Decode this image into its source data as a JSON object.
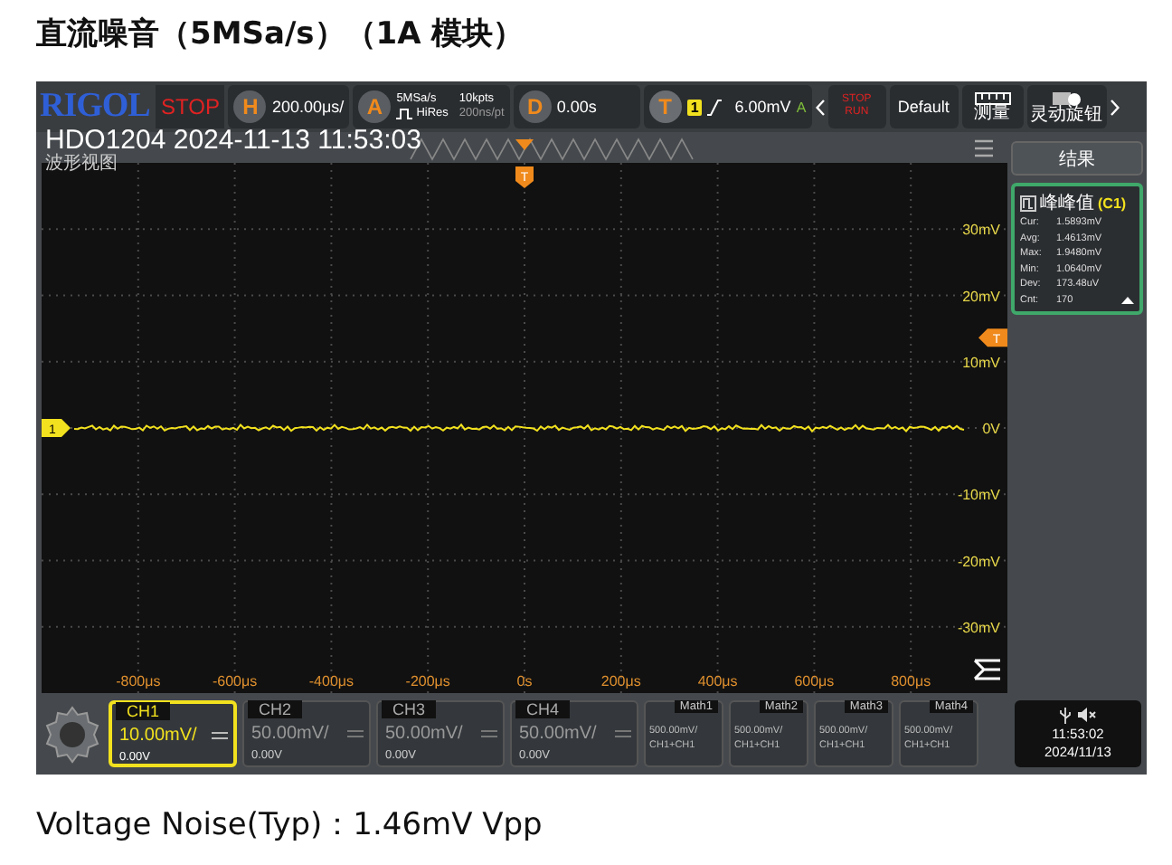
{
  "heading": "直流噪音（5MSa/s）（1A 模块）",
  "scope": {
    "top_bar": {
      "logo": "RIGOL",
      "run_state": "STOP",
      "horizontal": {
        "key": "H",
        "value": "200.00μs/"
      },
      "acquire": {
        "key": "A",
        "sample_rate": "5MSa/s",
        "depth": "10kpts",
        "mode": "HiRes",
        "interval": "200ns/pt"
      },
      "delay": {
        "key": "D",
        "value": "0.00s"
      },
      "trigger": {
        "key": "T",
        "source": "1",
        "level": "6.00mV",
        "mode": "A"
      },
      "buttons": [
        {
          "kind": "run_stop",
          "top": "STOP",
          "bottom": "RUN"
        },
        {
          "kind": "default",
          "label": "Default"
        },
        {
          "kind": "measure",
          "label": "测量"
        },
        {
          "kind": "knob",
          "label": "灵动旋钮"
        }
      ]
    },
    "overlay_title": "HDO1204 2024-11-13 11:53:03",
    "view_label": "波形视图",
    "grid": {
      "y_labels": [
        "30mV",
        "20mV",
        "10mV",
        "0V",
        "-10mV",
        "-20mV",
        "-30mV"
      ],
      "x_labels": [
        "-800μs",
        "-600μs",
        "-400μs",
        "-200μs",
        "0s",
        "200μs",
        "400μs",
        "600μs",
        "800μs"
      ],
      "channel_marker": "1",
      "trigger_position_marker": "T",
      "trigger_level_marker": "T"
    },
    "results": {
      "title": "结果",
      "card": {
        "title": "峰峰值",
        "source": "(C1)",
        "rows": [
          {
            "label": "Cur:",
            "value": "1.5893mV"
          },
          {
            "label": "Avg:",
            "value": "1.4613mV"
          },
          {
            "label": "Max:",
            "value": "1.9480mV"
          },
          {
            "label": "Min:",
            "value": "1.0640mV"
          },
          {
            "label": "Dev:",
            "value": "173.48uV"
          },
          {
            "label": "Cnt:",
            "value": "170"
          }
        ]
      }
    },
    "channels": [
      {
        "name": "CH1",
        "scale": "10.00mV/",
        "offset": "0.00V",
        "selected": true
      },
      {
        "name": "CH2",
        "scale": "50.00mV/",
        "offset": "0.00V",
        "selected": false
      },
      {
        "name": "CH3",
        "scale": "50.00mV/",
        "offset": "0.00V",
        "selected": false
      },
      {
        "name": "CH4",
        "scale": "50.00mV/",
        "offset": "0.00V",
        "selected": false
      }
    ],
    "math": [
      {
        "name": "Math1",
        "scale": "500.00mV/",
        "source": "CH1+CH1"
      },
      {
        "name": "Math2",
        "scale": "500.00mV/",
        "source": "CH1+CH1"
      },
      {
        "name": "Math3",
        "scale": "500.00mV/",
        "source": "CH1+CH1"
      },
      {
        "name": "Math4",
        "scale": "500.00mV/",
        "source": "CH1+CH1"
      }
    ],
    "status": {
      "time": "11:53:02",
      "date": "2024/11/13"
    }
  },
  "caption": "Voltage Noise(Typ)：1.46mV Vpp"
}
